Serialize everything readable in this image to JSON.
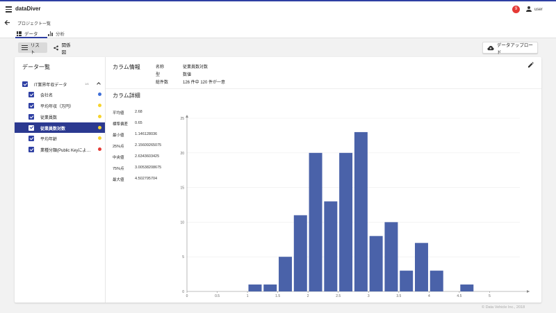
{
  "app": {
    "title": "dataDiver",
    "notification_count": "9",
    "user_label": "user"
  },
  "subheader": {
    "breadcrumb": "プロジェクト一覧",
    "tabs": [
      {
        "label": "データ",
        "active": true,
        "icon": "grid-icon"
      },
      {
        "label": "分析",
        "active": false,
        "icon": "bar-chart-icon"
      }
    ]
  },
  "toolbar": {
    "list_label": "リスト",
    "relation_label": "関係図",
    "upload_label": "データアップロード"
  },
  "data_list": {
    "title": "データ一覧",
    "group": {
      "label": "IT業界年収データ",
      "count": "1/6"
    },
    "items": [
      {
        "label": "会社名",
        "dot_color": "#3f6fd8",
        "selected": false
      },
      {
        "label": "平均年収（万円）",
        "dot_color": "#f6d32c",
        "selected": false
      },
      {
        "label": "従業員数",
        "dot_color": "#f6d32c",
        "selected": false
      },
      {
        "label": "従業員数対数",
        "dot_color": "#f6d32c",
        "selected": true
      },
      {
        "label": "平均年齢",
        "dot_color": "#f6d32c",
        "selected": false
      },
      {
        "label": "業種分類(Public Keyによ…",
        "dot_color": "#e53935",
        "selected": false
      }
    ]
  },
  "column_info": {
    "title": "カラム情報",
    "fields": [
      {
        "key": "名称",
        "value": "従業員数対数"
      },
      {
        "key": "型",
        "value": "数値"
      },
      {
        "key": "総件数",
        "value": "126 件中 120 件が一意"
      }
    ]
  },
  "column_detail": {
    "title": "カラム詳細",
    "stats": [
      {
        "key": "平均値",
        "value": "2.68"
      },
      {
        "key": "標準偏差",
        "value": "0.65"
      },
      {
        "key": "最小値",
        "value": "1.146128036"
      },
      {
        "key": "25%点",
        "value": "2.15609265075"
      },
      {
        "key": "中央値",
        "value": "2.6343603425"
      },
      {
        "key": "75%点",
        "value": "3.00538208675"
      },
      {
        "key": "最大値",
        "value": "4.502795704"
      }
    ]
  },
  "chart_data": {
    "type": "bar",
    "title": "",
    "xlabel": "",
    "ylabel": "",
    "bar_color": "#4a62a9",
    "xlim": [
      0,
      5.5
    ],
    "ylim": [
      0,
      25
    ],
    "x_ticks": [
      "0",
      "0.5",
      "1",
      "1.5",
      "2",
      "2.5",
      "3",
      "3.5",
      "4",
      "4.5",
      "5"
    ],
    "y_ticks": [
      "0",
      "5",
      "10",
      "15",
      "20",
      "25"
    ],
    "bin_width": 0.25,
    "bins": [
      {
        "x0": 1.0,
        "value": 1
      },
      {
        "x0": 1.25,
        "value": 1
      },
      {
        "x0": 1.5,
        "value": 5
      },
      {
        "x0": 1.75,
        "value": 11
      },
      {
        "x0": 2.0,
        "value": 20
      },
      {
        "x0": 2.25,
        "value": 13
      },
      {
        "x0": 2.5,
        "value": 20
      },
      {
        "x0": 2.75,
        "value": 23
      },
      {
        "x0": 3.0,
        "value": 8
      },
      {
        "x0": 3.25,
        "value": 10
      },
      {
        "x0": 3.5,
        "value": 3
      },
      {
        "x0": 3.75,
        "value": 7
      },
      {
        "x0": 4.0,
        "value": 3
      },
      {
        "x0": 4.25,
        "value": 0
      },
      {
        "x0": 4.5,
        "value": 1
      }
    ]
  },
  "footer": {
    "copyright": "© Data Vehicle Inc., 2018"
  }
}
